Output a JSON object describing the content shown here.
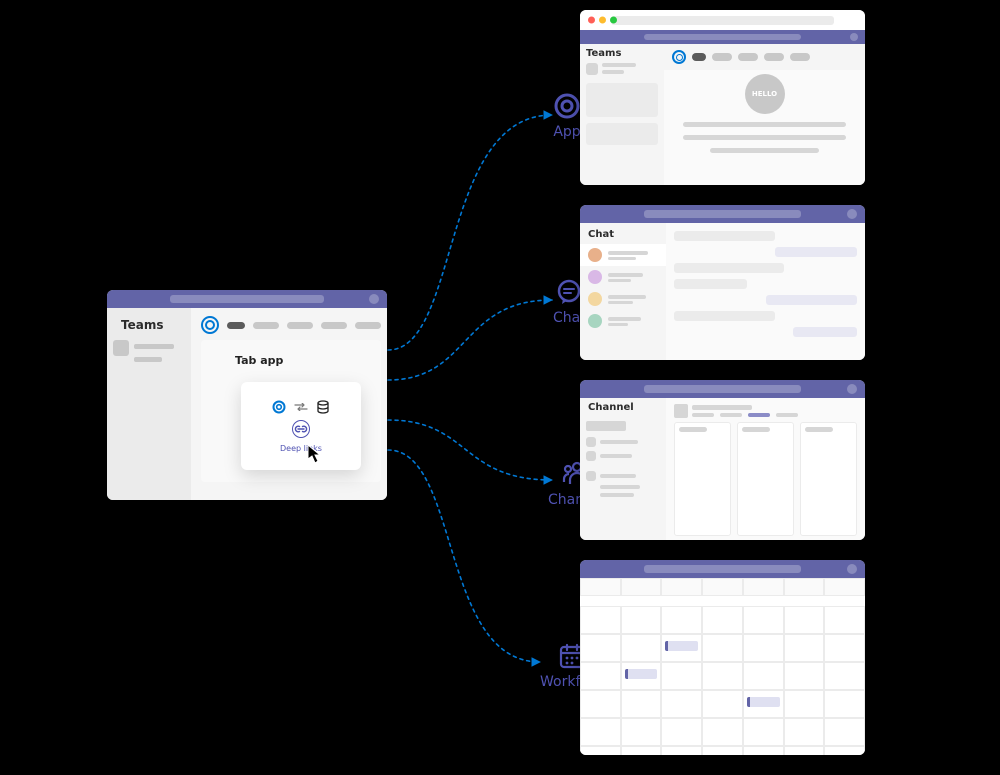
{
  "source": {
    "sidebar_title": "Teams",
    "panel_title": "Tab app",
    "deep_links_label": "Deep links"
  },
  "targets": {
    "app": {
      "label": "App",
      "sidebar_title": "Teams",
      "hello": "HELLO"
    },
    "chat": {
      "label": "Chat",
      "sidebar_title": "Chat"
    },
    "channel": {
      "label": "Channel",
      "sidebar_title": "Channel"
    },
    "workflow": {
      "label": "Workflow"
    }
  },
  "colors": {
    "purple": "#6264A7",
    "blue": "#0078D4",
    "ink": "#4F52B2"
  }
}
